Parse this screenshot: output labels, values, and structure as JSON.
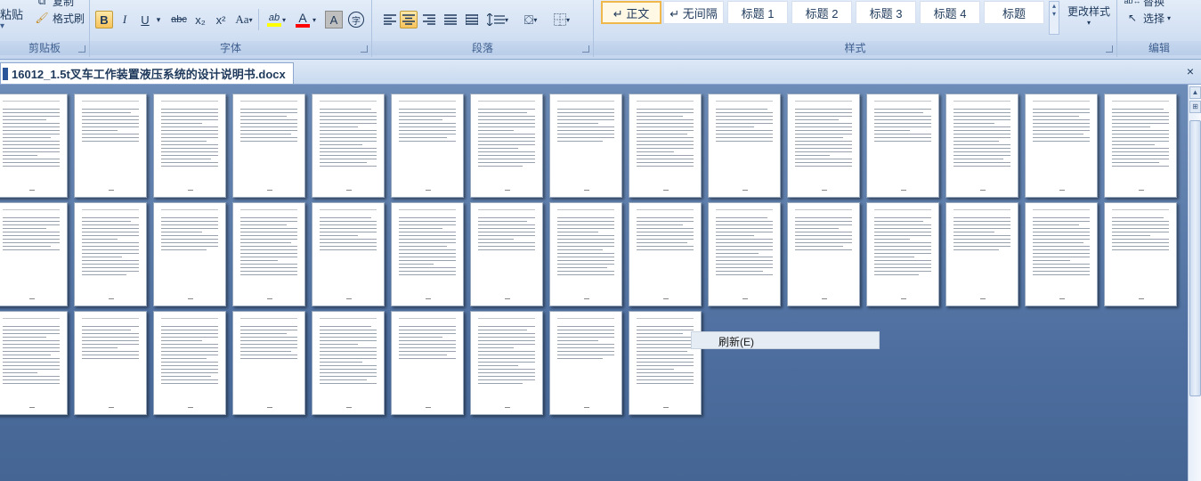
{
  "ribbon": {
    "clipboard": {
      "paste_label": "粘贴",
      "copy_label": "复制",
      "format_painter_label": "格式刷",
      "group_label": "剪贴板"
    },
    "font": {
      "group_label": "字体",
      "bold": "B",
      "italic": "I",
      "underline": "U",
      "strike": "abc",
      "subscript": "x₂",
      "superscript": "x²",
      "change_case": "Aa",
      "highlight": "ab",
      "font_color": "A",
      "char_shading": "A",
      "enclose": "字"
    },
    "paragraph": {
      "group_label": "段落"
    },
    "styles": {
      "group_label": "样式",
      "items": [
        {
          "label": "↵ 正文"
        },
        {
          "label": "↵ 无间隔"
        },
        {
          "label": "标题 1"
        },
        {
          "label": "标题 2"
        },
        {
          "label": "标题 3"
        },
        {
          "label": "标题 4"
        },
        {
          "label": "标题"
        }
      ],
      "change_styles_label": "更改样式"
    },
    "editing": {
      "replace_label": "替换",
      "select_label": "选择",
      "group_label": "编辑"
    }
  },
  "document": {
    "tab_title": "16012_1.5t叉车工作装置液压系统的设计说明书.docx",
    "close_glyph": "×"
  },
  "context_menu": {
    "refresh_label": "刷新(E)"
  },
  "colors": {
    "highlight_color": "#ffff00",
    "font_color": "#ff0000",
    "workspace": "#4c6d9e"
  }
}
